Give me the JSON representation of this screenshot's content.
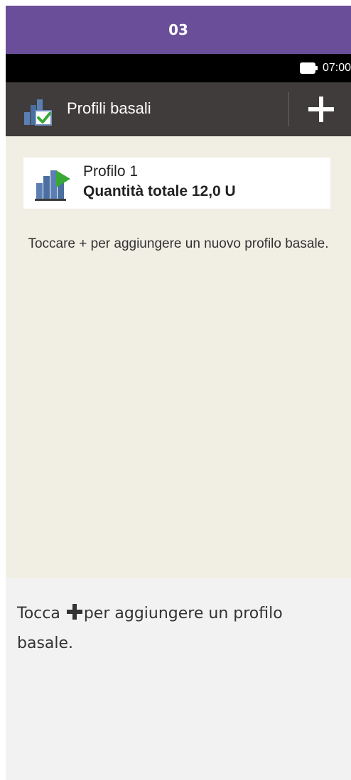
{
  "step": {
    "number": "03"
  },
  "statusbar": {
    "battery_icon": "battery-icon",
    "time": "07:00"
  },
  "titlebar": {
    "icon": "basal-profile-check-icon",
    "title": "Profili basali",
    "add_icon": "plus-icon"
  },
  "profiles": [
    {
      "icon": "basal-profile-active-icon",
      "name": "Profilo 1",
      "total": "Quantità totale 12,0 U"
    }
  ],
  "screen": {
    "hint": "Toccare + per aggiungere un nuovo profilo basale."
  },
  "instruction": {
    "prefix": "Tocca",
    "icon": "plus-icon",
    "suffix": "per aggiungere un profilo basale."
  },
  "colors": {
    "step_header": "#6b4e9a",
    "titlebar": "#403c3b",
    "screen_bg": "#f1eee4",
    "icon_blue": "#4a6fa0",
    "check_green": "#39a935"
  }
}
